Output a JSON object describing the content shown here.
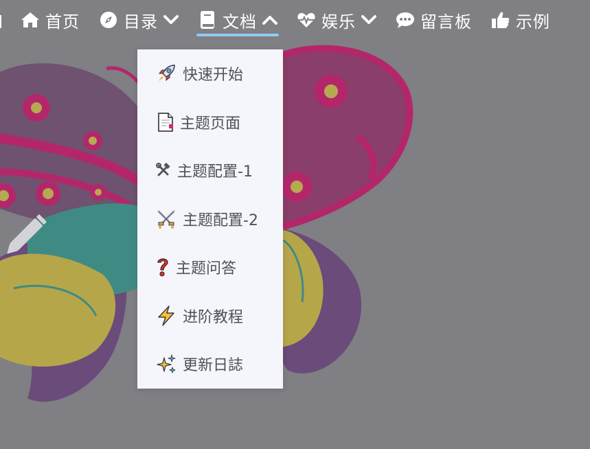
{
  "nav": {
    "items": [
      {
        "label": "",
        "icon": "partial-icon"
      },
      {
        "label": "首页",
        "icon": "home-icon"
      },
      {
        "label": "目录",
        "icon": "compass-icon",
        "has_dropdown": true
      },
      {
        "label": "文档",
        "icon": "book-icon",
        "has_dropdown": true,
        "active": true,
        "expanded": true
      },
      {
        "label": "娱乐",
        "icon": "heartbeat-icon",
        "has_dropdown": true
      },
      {
        "label": "留言板",
        "icon": "comment-icon"
      },
      {
        "label": "示例",
        "icon": "thumbs-up-icon"
      }
    ],
    "active_underline_color": "#8fcbf5"
  },
  "dropdown": {
    "items": [
      {
        "label": "快速开始",
        "icon": "rocket-icon"
      },
      {
        "label": "主题页面",
        "icon": "page-icon"
      },
      {
        "label": "主题配置-1",
        "icon": "hammer-wrench-icon"
      },
      {
        "label": "主题配置-2",
        "icon": "crossed-swords-icon"
      },
      {
        "label": "主题问答",
        "icon": "question-mark-icon"
      },
      {
        "label": "进阶教程",
        "icon": "lightning-icon"
      },
      {
        "label": "更新日誌",
        "icon": "sparkles-icon"
      }
    ]
  }
}
